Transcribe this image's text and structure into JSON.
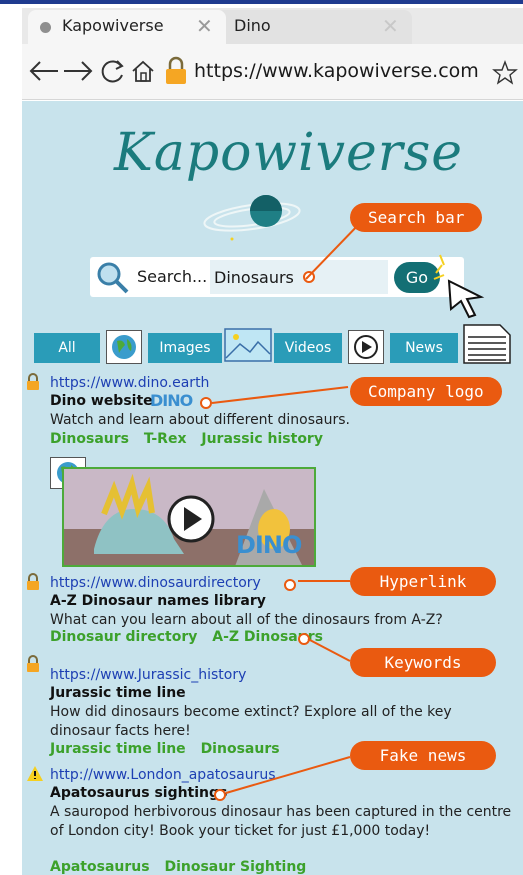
{
  "browser": {
    "tabs": [
      {
        "title": "Kapowiverse",
        "active": true
      },
      {
        "title": "Dino",
        "active": false
      }
    ],
    "url": "https://www.kapowiverse.com"
  },
  "site": {
    "logo": "Kapowiverse",
    "search": {
      "label": "Search...",
      "value": "Dinosaurs",
      "go_label": "Go"
    },
    "filters": [
      {
        "label": "All",
        "icon": "globe-icon"
      },
      {
        "label": "Images",
        "icon": "image-icon"
      },
      {
        "label": "Videos",
        "icon": "play-icon"
      },
      {
        "label": "News",
        "icon": "newspaper-icon"
      }
    ]
  },
  "callouts": {
    "search_bar": "Search bar",
    "company_logo": "Company logo",
    "hyperlink": "Hyperlink",
    "keywords": "Keywords",
    "fake_news": "Fake news"
  },
  "results": [
    {
      "url": "https://www.dino.earth",
      "title": "Dino website",
      "logo": "DINO",
      "description": "Watch and learn about different dinosaurs.",
      "tags": [
        "Dinosaurs",
        "T-Rex",
        "Jurassic history"
      ],
      "status_icon": "lock-icon",
      "video_logo": "DINO"
    },
    {
      "url": "https://www.dinosaurdirectory",
      "title": "A-Z Dinosaur names library",
      "description": "What can you learn about all of the dinosaurs from A-Z?",
      "tags": [
        "Dinosaur directory",
        "A-Z Dinosaurs"
      ],
      "status_icon": "lock-icon"
    },
    {
      "url": "https://www.Jurassic_history",
      "title": "Jurassic time line",
      "description": "How did dinosaurs become extinct? Explore all of the key dinosaur facts here!",
      "tags": [
        "Jurassic time line",
        "Dinosaurs"
      ],
      "status_icon": "lock-icon"
    },
    {
      "url": "http://www.London_apatosaurus",
      "title": "Apatosaurus sightings",
      "description": "A sauropod herbivorous dinosaur has been captured in the centre of London city! Book your ticket for just £1,000 today!",
      "tags": [
        "Apatosaurus",
        "Dinosaur Sighting"
      ],
      "status_icon": "warning-icon"
    }
  ],
  "colors": {
    "page_bg": "#c8e3ec",
    "accent": "#ea5a10",
    "link": "#1d3fb3",
    "tag": "#3ca12b",
    "filter_btn": "#2a9cb8",
    "logo": "#1b7b7d"
  }
}
